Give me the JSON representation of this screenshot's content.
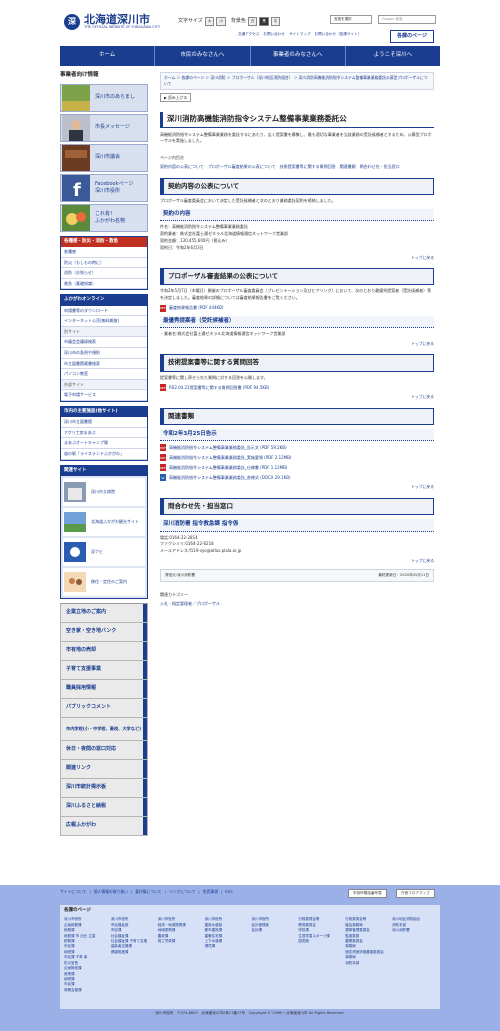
{
  "header": {
    "logo_mark": "深",
    "title": "北海道深川市",
    "subtitle": "THE OFFICIAL WEBSITE OF FUKAGAWA CITY",
    "font_size_label": "文字サイズ",
    "font_large": "大",
    "font_small": "小",
    "color_label": "背景色",
    "color_white": "白",
    "color_black": "黒",
    "color_gray": "灰",
    "language": "言語を選択",
    "search_placeholder": "Google 検索",
    "links": [
      "交通アクセス",
      "お問い合わせ",
      "サイトマップ",
      "お問い合わせ（各課サイト）"
    ],
    "kakuka_button": "各課のページ"
  },
  "gnav": [
    "ホーム",
    "市民のみなさんへ",
    "事業者のみなさんへ",
    "ようこそ深川へ"
  ],
  "sidebar": {
    "title": "事業者向け情報",
    "pic_items": [
      {
        "label": "深川市のあらまし"
      },
      {
        "label": "市長メッセージ"
      },
      {
        "label": "深川市議会"
      },
      {
        "label": "Facebookページ\n深川市役所"
      },
      {
        "label": "これ有！\nふかがわ名物"
      }
    ],
    "emergency": {
      "title": "各種感・防災・消防・救急",
      "items": [
        "各種感",
        "防災（もしもの時に）",
        "消防（お知らせ）",
        "救急（基礎知識）"
      ]
    },
    "online": {
      "title": "ふかがわオンライン",
      "items": [
        "申請書等のダウンロード",
        "インターネット公売(無料開放)",
        "別サイト",
        "市議会会議録検索",
        "深川市の条例や規則",
        "市立図書館蔵書検索",
        "パソコン教室",
        "外部サイト",
        "電子申請サービス"
      ]
    },
    "notice": {
      "title": "市内の主要施設(他サイト)",
      "items": [
        "深川市立図書館",
        "アグリ工房まあぶ",
        "まあぶオートキャンプ場",
        "道の駅「ライスランドふかがわ」"
      ]
    },
    "related": {
      "title": "関連サイト",
      "items": [
        "深川市立病院",
        "北海道ふかがわ観光サイト",
        "深ナビ",
        "移住・定住のご案内"
      ]
    },
    "big_nav": [
      "企業立地のご案内",
      "空き家・空き地バンク",
      "市有地の売却",
      "子育て支援事業",
      "職員採用情報",
      "パブリックコメント",
      "市内学校(小・中学校、高校、大学など)",
      "休日・夜間の窓口対応",
      "関連リンク",
      "深川市統計掲示板",
      "深川ふるさと納税",
      "広報ふかがわ"
    ]
  },
  "main": {
    "breadcrumb": "ホーム ＞ 各課のページ ＞ 深川消防 ＞ ブロポーザル（深川地区消防組合） ＞ 深川消防高機能消防指令システム整備事業業務委託公募型プロポーザルについて",
    "read_button": "読み上げる",
    "title": "深川消防高機能消防指令システム整備事業業務委託公",
    "intro": "高機能消防指令システム整備事業業務を委託するにあたり、広く提案書を募集し、最も適切な事業者を当該業務の受託候補者とするため、公募型プロポーザルを実施しました。",
    "toc_head": "ページ内目次",
    "toc": "契約内容の公表について　プロポーザル審査結果の公表について　技術提案書等に関する質問回答　関連書類　問合わせ先・担当窓口",
    "s1_h2": "契約内容の公表について",
    "s1_text": "プロポーザル審査委員会において決定した受託候補者と次のとおり業務委託契約を締結しました。",
    "s1_h3": "契約の内容",
    "s1_detail": "件名：高機能消防指令システム整備事業業務委託\n契約業者：株式会社富士通ゼネラル北海道情報通信ネットワーク営業部\n契約金額：130,455,600円（税込み）\n契約日：令和2年6月3日",
    "totop": "トップに戻る",
    "s2_h2": "プロポーザル審査結果の公表について",
    "s2_text": "令和2年5月7日（木曜日）開催のプロポーザル審査委員会（プレゼンテーション及びヒアリング）において、次のとおり最優秀提案者（受託候補者）等を決定しました。審査結果の詳細については審査結果報告書をご覧ください。",
    "s2_pdf": "審査結果報告書 (PDF 444KB)",
    "s2_h3": "最優秀提案者（受託候補者）",
    "s2_detail": "・業者名:株式会社富士通ゼネラル北海道情報通信ネットワーク営業部",
    "s3_h2": "技術提案書等に関する質問回答",
    "s3_text": "提案書等に関し寄せられた質問に対する回答を公開します。",
    "s3_pdf": "R02.04.21提案書等に関する質問回答書 (PDF 94.5KB)",
    "s4_h2": "関連書類",
    "s4_h3": "令和2年3月25日告示",
    "s4_files": [
      {
        "type": "pdf",
        "label": "高機能消防指令システム整備事業業務委託_告示文 (PDF 59.2KB)"
      },
      {
        "type": "pdf",
        "label": "高機能消防指令システム整備事業業務委託_実施要領 (PDF 2.12MB)"
      },
      {
        "type": "pdf",
        "label": "高機能消防指令システム整備事業業務委託_仕様書 (PDF 1.12MB)"
      },
      {
        "type": "doc",
        "label": "高機能消防指令システム整備事業業務委託_各様式 (DOCX 29.1KB)"
      }
    ],
    "s5_h2": "問合わせ先・担当窓口",
    "s5_h3": "深川消防署 指令救急課 指令係",
    "s5_detail": "電話:0164-22-2814\nファクシミリ:0164-22-6218\nメールアドレス:f119-syo@atlas.plala.or.jp",
    "source_label": "発信元:深川消防署",
    "updated": "最終更新日：2020年05月11日",
    "category_title": "関連カテゴリー",
    "category_value": "入札・指定管理者／プロポーザル"
  },
  "footer": {
    "links": [
      "サイトについて",
      "個人情報の取り扱い",
      "著作権について",
      "リンクについて",
      "免責事項",
      "RSS"
    ],
    "btn1": "市役所電話番号表",
    "btn2": "庁舎フロアマップ",
    "panel_title": "各課のページ",
    "cols": [
      [
        "深川市役所",
        "企画総務課",
        "総務課",
        "総務課 市 出仕 立直",
        "税務課",
        "市民課",
        "納税課",
        "市民課 子育 事",
        "防災室長",
        "企画財政課",
        "政策課",
        "納税課",
        "市民課",
        "商業会管課"
      ],
      [
        "深川市役所",
        "市民福祉部",
        "市民課",
        "社会福祉課",
        "社会福祉課 子育て支援",
        "高齢者支援課",
        "健康推進課"
      ],
      [
        "深川市役所",
        "経済・地域振興課",
        "地域振興課",
        "農政課",
        "商工労政課"
      ],
      [
        "深川市役所",
        "建設水道部",
        "都市建設課",
        "建築住宅課",
        "上下水道課",
        "環境課"
      ],
      [
        "深川市役所",
        "会計管理者",
        "会計課"
      ],
      [
        "行政委員会等",
        "教育委員会",
        "学校課",
        "生涯学習スポーツ課",
        "図書館"
      ],
      [
        "行政委員会等",
        "議会事務局",
        "選挙管理委員会",
        "監査委員",
        "農業委員会",
        "事務局",
        "固定資産評価審査委員会",
        "事務局",
        "消防本部"
      ],
      [
        "深川地区消防組合",
        "消防本部",
        "深川消防署"
      ]
    ],
    "bottom": "深川市役所　〒074-8650　北海道深川市2条17番17号　Copyright © 1996〜 北海道深川市 All Rights Reserved."
  }
}
